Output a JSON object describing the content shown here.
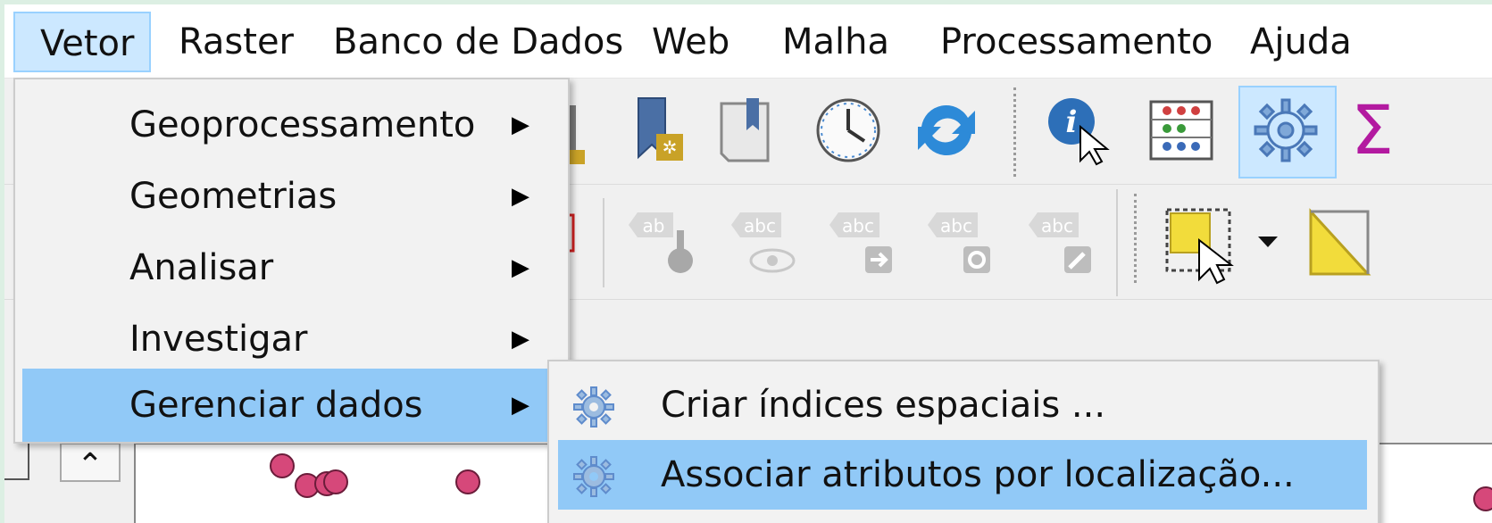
{
  "menubar": {
    "items": [
      {
        "label": "Vetor",
        "active": true
      },
      {
        "label": "Raster"
      },
      {
        "label": "Banco de Dados"
      },
      {
        "label": "Web"
      },
      {
        "label": "Malha"
      },
      {
        "label": "Processamento"
      },
      {
        "label": "Ajuda"
      }
    ]
  },
  "vector_menu": {
    "items": [
      {
        "label": "Geoprocessamento",
        "has_submenu": true
      },
      {
        "label": "Geometrias",
        "has_submenu": true
      },
      {
        "label": "Analisar",
        "has_submenu": true
      },
      {
        "label": "Investigar",
        "has_submenu": true
      },
      {
        "label": "Gerenciar dados",
        "has_submenu": true,
        "highlighted": true
      }
    ],
    "submenu_arrow": "▶"
  },
  "data_management_submenu": {
    "items": [
      {
        "label": "Criar índices espaciais ...",
        "icon": "gear-icon"
      },
      {
        "label": "Associar atributos por localização...",
        "icon": "gear-icon",
        "highlighted": true
      }
    ]
  },
  "toolbar": {
    "icons": [
      "new-bookmark-icon",
      "bookmark-manager-icon",
      "temporal-controller-icon",
      "refresh-icon",
      "identify-features-icon",
      "field-calculator-icon",
      "processing-toolbox-icon",
      "statistics-sum-icon"
    ],
    "label_toolbar_icons": [
      "label-pin-icon",
      "label-show-hide-icon",
      "label-move-icon",
      "label-rotate-icon",
      "label-change-icon"
    ],
    "selection_icons": [
      "select-features-icon",
      "select-dropdown-icon",
      "select-polygon-icon"
    ]
  },
  "colors": {
    "menu_highlight": "#91c9f7",
    "menubar_active": "#cce8ff",
    "feature_point": "#d6487a"
  }
}
